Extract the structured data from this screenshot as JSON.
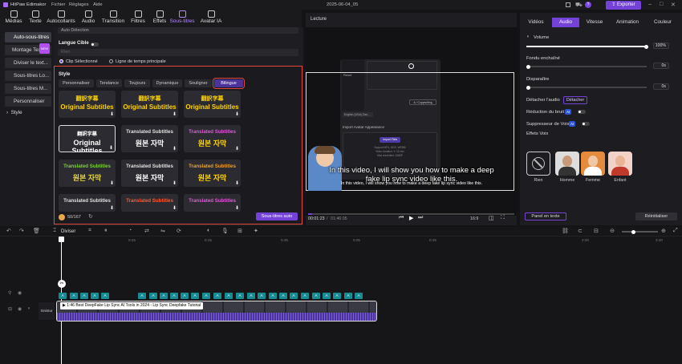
{
  "app": {
    "name": "HitPaw Edimakor",
    "menu": [
      "Fichier",
      "Réglages",
      "Aide"
    ],
    "project": "2025-06-04_05",
    "export_label": "Exporter",
    "help_badge": "?"
  },
  "toolbar": [
    {
      "label": "Médias",
      "icon": "media-icon"
    },
    {
      "label": "Texte",
      "icon": "text-icon"
    },
    {
      "label": "Autocollants",
      "icon": "sticker-icon"
    },
    {
      "label": "Audio",
      "icon": "audio-icon"
    },
    {
      "label": "Transition",
      "icon": "transition-icon"
    },
    {
      "label": "Filtres",
      "icon": "filter-icon"
    },
    {
      "label": "Effets",
      "icon": "effects-icon"
    },
    {
      "label": "Sous-titres",
      "icon": "subtitles-icon",
      "active": true
    },
    {
      "label": "Avatar IA",
      "icon": "avatar-icon"
    }
  ],
  "leftnav": {
    "items": [
      "Auto-sous-titres",
      "Montage Textuel",
      "Diviser le text...",
      "Sous-titres Lo...",
      "Sous-titres M...",
      "Personnaliser"
    ],
    "style_label": "Style",
    "new_badge": "NEW"
  },
  "subtitles": {
    "detect_value": "Auto Détection",
    "target_lang_label": "Langue Cible",
    "target_lang_value": "Rien",
    "radio_clip": "Clip Sélectionné",
    "radio_timeline": "Ligne de temps principale",
    "style_title": "Style",
    "style_tabs": [
      "Personnaliser",
      "Tendance",
      "Toujours",
      "Dynamique",
      "Souligner",
      "Bilingue"
    ],
    "tiles": [
      {
        "l1": "翻訳字幕",
        "l2": "Original Subtitles",
        "c1": "#ffd400",
        "c2": "#ffd400"
      },
      {
        "l1": "翻訳字幕",
        "l2": "Original Subtitles",
        "c1": "#ffd400",
        "c2": "#ffd400"
      },
      {
        "l1": "翻訳字幕",
        "l2": "Original Subtitles",
        "c1": "#ffd400",
        "c2": "#ffd400"
      },
      {
        "l1": "翻訳字幕",
        "l2": "Original Subtitles",
        "c1": "#ffffff",
        "c2": "#ffffff"
      },
      {
        "l1": "Translated Subtitles",
        "l2": "원본 자막",
        "c1": "#e0e0e0",
        "c2": "#ffffff"
      },
      {
        "l1": "Translated Subtitles",
        "l2": "원본 자막",
        "c1": "#e05ad8",
        "c2": "#ffd400"
      },
      {
        "l1": "Translated Subtitles",
        "l2": "원본 자막",
        "c1": "#7cd32f",
        "c2": "#e8d63a"
      },
      {
        "l1": "Translated Subtitles",
        "l2": "원본 자막",
        "c1": "#e0e0e0",
        "c2": "#ffffff"
      },
      {
        "l1": "Translated Subtitles",
        "l2": "원본 자막",
        "c1": "#f0a020",
        "c2": "#ffd400"
      },
      {
        "l1": "Translated Subtitles",
        "l2": "",
        "c1": "#e0e0e0",
        "c2": "#ffffff"
      },
      {
        "l1": "Translated Subtitles",
        "l2": "",
        "c1": "#ff5a30",
        "c2": "#ffd400"
      },
      {
        "l1": "Translated Subtitles",
        "l2": "",
        "c1": "#e05ad8",
        "c2": "#ffd400"
      }
    ],
    "credits": "50/167",
    "auto_button": "Sous-titres auto"
  },
  "preview": {
    "title": "Lecture",
    "caption_line1": "In this video, I will show you how to make a deep",
    "caption_line2": "fake lip sync video like this.",
    "caption_small": "In this video, I will show you how to make a deep fake lip sync video like this.",
    "time_current": "00:01:23",
    "time_total": "01:46:05",
    "ratio": "16:9",
    "screen": {
      "import_title": "Import Avatar Appearance",
      "import_files": "Import Files",
      "upgrade": "Upgrade",
      "language": "English (USA) Dav...",
      "reset": "Reset",
      "upload": "Upload video",
      "hint": "Support MP4, MOV, WEBM",
      "hint2": "Video duration: 1~10 min",
      "hint3": "Max resolution: 1080P",
      "cursor_label": "A / Copywriting"
    }
  },
  "right": {
    "tabs": [
      "Vidéos",
      "Audio",
      "Vitesse",
      "Animation",
      "Couleur"
    ],
    "volume_label": "Volume",
    "volume_value": "100%",
    "fade_in_label": "Fondu enchaîné",
    "fade_in_value": "0s",
    "fade_out_label": "Disparaître",
    "fade_out_value": "0s",
    "detach_label": "Détacher l'audio",
    "detach_button": "Détacher",
    "noise_label": "Réduction du bruit",
    "ai": "AI",
    "voice_remove_label": "Suppresseur de Voix",
    "voice_fx_label": "Effets Voix",
    "voices": [
      "Rien",
      "Homme",
      "Femme",
      "Enfant"
    ],
    "text_panel": "Panel en texte",
    "reset": "Réinitialiser",
    "volume": 1.0
  },
  "timeline": {
    "split_label": "Diviser",
    "ruler": [
      "0:25",
      "0:15",
      "0:35",
      "0:05",
      "0:25",
      "2:20",
      "3:20"
    ],
    "track_label": "Sinistur",
    "clip_title": "1:46 Best DeepFake Lip Sync AI Tools in 2024 - Lip Sync Deepfake Tutorial",
    "clip_label_short": "A"
  }
}
